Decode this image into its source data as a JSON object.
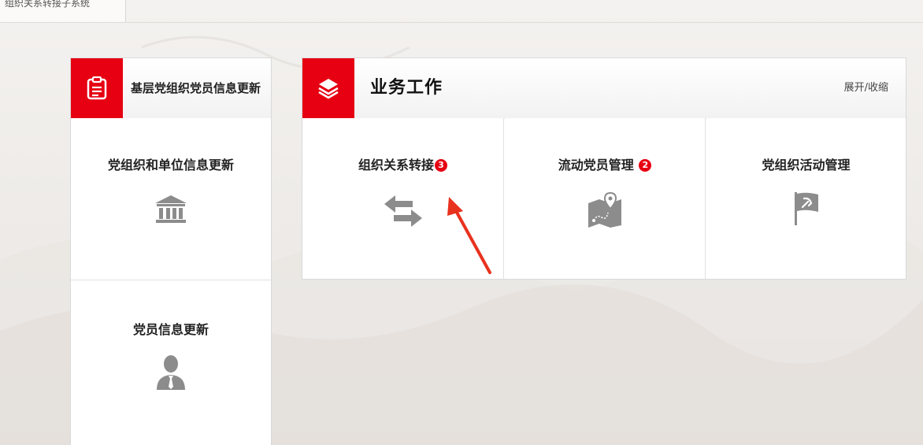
{
  "topbar": {
    "tab_label": "组织关系转接子系统"
  },
  "left_panel": {
    "title": "基层党组织党员信息更新",
    "header_icon": "clipboard-icon",
    "items": [
      {
        "label": "党组织和单位信息更新",
        "icon": "bank-building-icon"
      },
      {
        "label": "党员信息更新",
        "icon": "person-tie-icon"
      }
    ]
  },
  "right_panel": {
    "title": "业务工作",
    "header_icon": "layers-icon",
    "toggle_label": "展开/收缩",
    "items": [
      {
        "label": "组织关系转接",
        "badge": "3",
        "icon": "transfer-arrows-icon"
      },
      {
        "label": "流动党员管理",
        "badge": "2",
        "icon": "map-pin-icon"
      },
      {
        "label": "党组织活动管理",
        "badge": "",
        "icon": "party-flag-icon"
      }
    ]
  },
  "colors": {
    "accent_red": "#e60012",
    "icon_gray": "#8c8c8c"
  }
}
